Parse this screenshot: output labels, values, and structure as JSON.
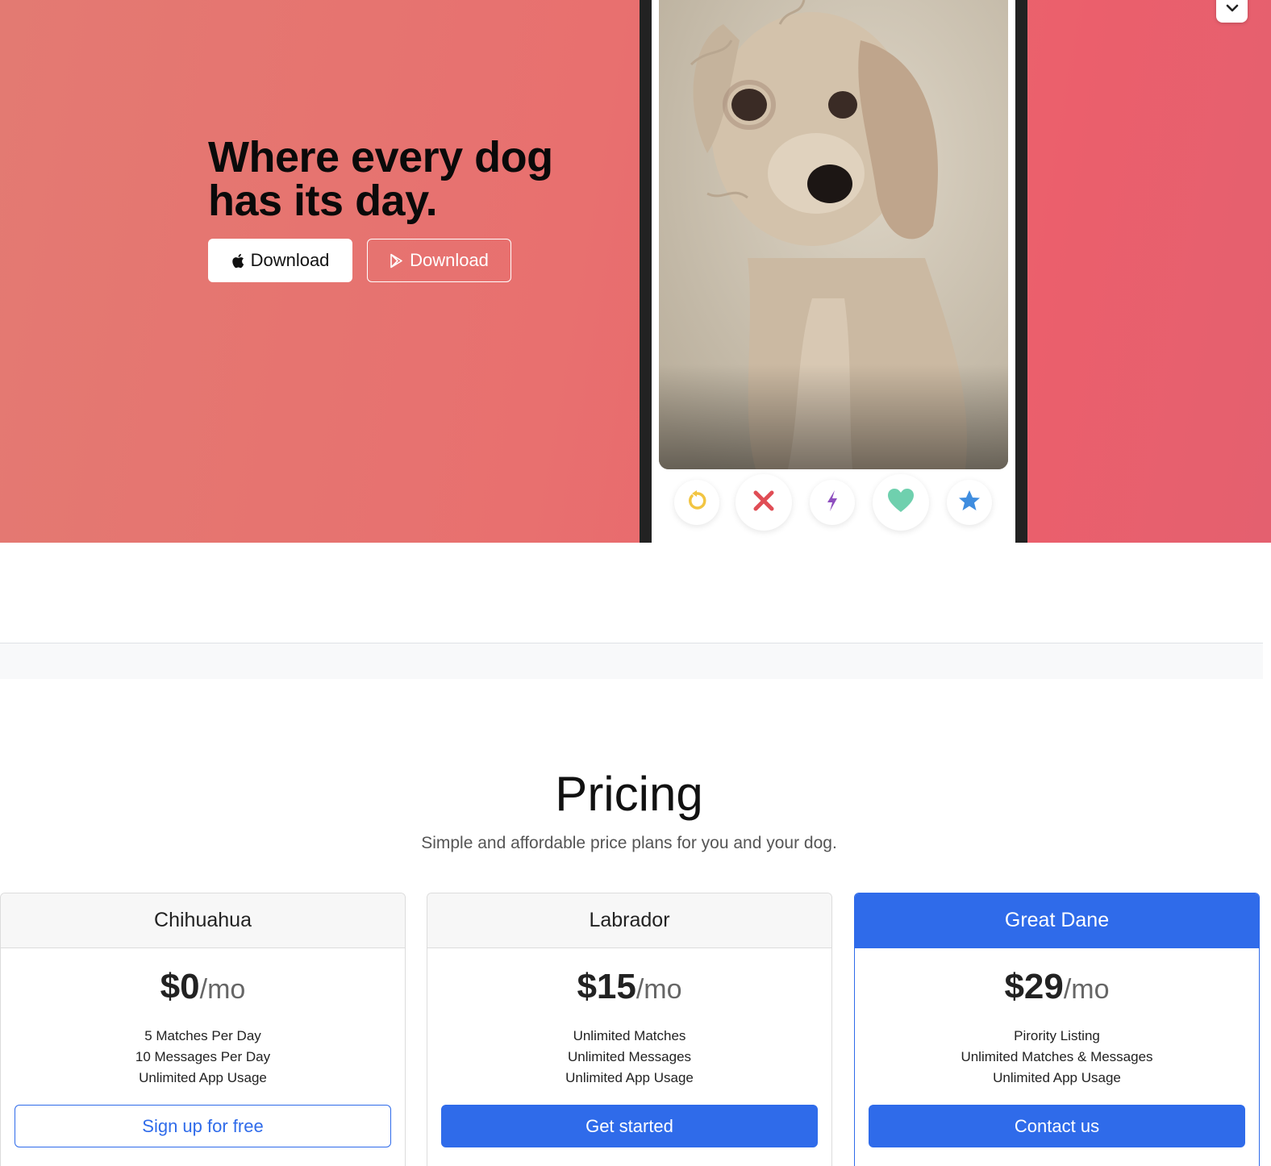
{
  "hero": {
    "title": "Where every dog has its day.",
    "buttons": [
      {
        "label": "Download",
        "icon": "apple-icon"
      },
      {
        "label": "Download",
        "icon": "google-play-icon"
      }
    ],
    "phone_actions": [
      "rewind-icon",
      "nope-icon",
      "boost-icon",
      "like-icon",
      "superlike-icon"
    ],
    "colors": {
      "gradient_start": "#e37a72",
      "gradient_end": "#eb5f6c"
    }
  },
  "pricing": {
    "title": "Pricing",
    "subtitle": "Simple and affordable price plans for you and your dog.",
    "plans": [
      {
        "name": "Chihuahua",
        "price": "$0",
        "period": "/mo",
        "features": [
          "5 Matches Per Day",
          "10 Messages Per Day",
          "Unlimited App Usage"
        ],
        "cta": "Sign up for free"
      },
      {
        "name": "Labrador",
        "price": "$15",
        "period": "/mo",
        "features": [
          "Unlimited Matches",
          "Unlimited Messages",
          "Unlimited App Usage"
        ],
        "cta": "Get started"
      },
      {
        "name": "Great Dane",
        "price": "$29",
        "period": "/mo",
        "features": [
          "Pirority Listing",
          "Unlimited Matches & Messages",
          "Unlimited App Usage"
        ],
        "cta": "Contact us"
      }
    ],
    "accent_color": "#2f6bea"
  }
}
